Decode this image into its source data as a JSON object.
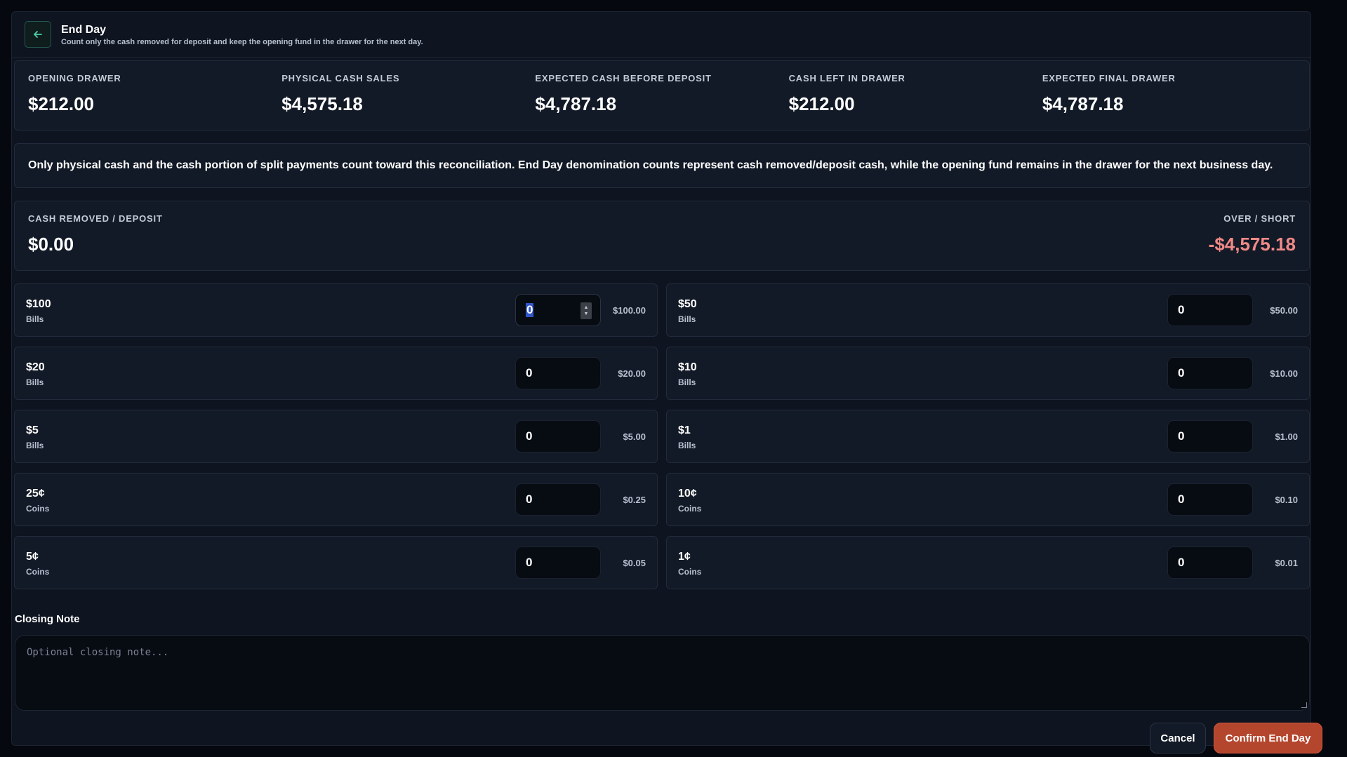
{
  "header": {
    "title": "End Day",
    "subtitle": "Count only the cash removed for deposit and keep the opening fund in the drawer for the next day."
  },
  "summary": [
    {
      "label": "OPENING DRAWER",
      "value": "$212.00"
    },
    {
      "label": "PHYSICAL CASH SALES",
      "value": "$4,575.18"
    },
    {
      "label": "EXPECTED CASH BEFORE DEPOSIT",
      "value": "$4,787.18"
    },
    {
      "label": "CASH LEFT IN DRAWER",
      "value": "$212.00"
    },
    {
      "label": "EXPECTED FINAL DRAWER",
      "value": "$4,787.18"
    }
  ],
  "notice": "Only physical cash and the cash portion of split payments count toward this reconciliation. End Day denomination counts represent cash removed/deposit cash, while the opening fund remains in the drawer for the next business day.",
  "deposit": {
    "label": "CASH REMOVED / DEPOSIT",
    "value": "$0.00",
    "short_label": "OVER / SHORT",
    "short_value": "-$4,575.18"
  },
  "denominations": [
    {
      "name": "$100",
      "kind": "Bills",
      "count": "0",
      "total": "$100.00"
    },
    {
      "name": "$50",
      "kind": "Bills",
      "count": "0",
      "total": "$50.00"
    },
    {
      "name": "$20",
      "kind": "Bills",
      "count": "0",
      "total": "$20.00"
    },
    {
      "name": "$10",
      "kind": "Bills",
      "count": "0",
      "total": "$10.00"
    },
    {
      "name": "$5",
      "kind": "Bills",
      "count": "0",
      "total": "$5.00"
    },
    {
      "name": "$1",
      "kind": "Bills",
      "count": "0",
      "total": "$1.00"
    },
    {
      "name": "25¢",
      "kind": "Coins",
      "count": "0",
      "total": "$0.25"
    },
    {
      "name": "10¢",
      "kind": "Coins",
      "count": "0",
      "total": "$0.10"
    },
    {
      "name": "5¢",
      "kind": "Coins",
      "count": "0",
      "total": "$0.05"
    },
    {
      "name": "1¢",
      "kind": "Coins",
      "count": "0",
      "total": "$0.01"
    }
  ],
  "closing_note": {
    "label": "Closing Note",
    "placeholder": "Optional closing note..."
  },
  "buttons": {
    "cancel": "Cancel",
    "confirm": "Confirm End Day"
  },
  "colors": {
    "accent": "#4fd1a5",
    "negative": "#f08a87",
    "confirm": "#b5462e"
  }
}
